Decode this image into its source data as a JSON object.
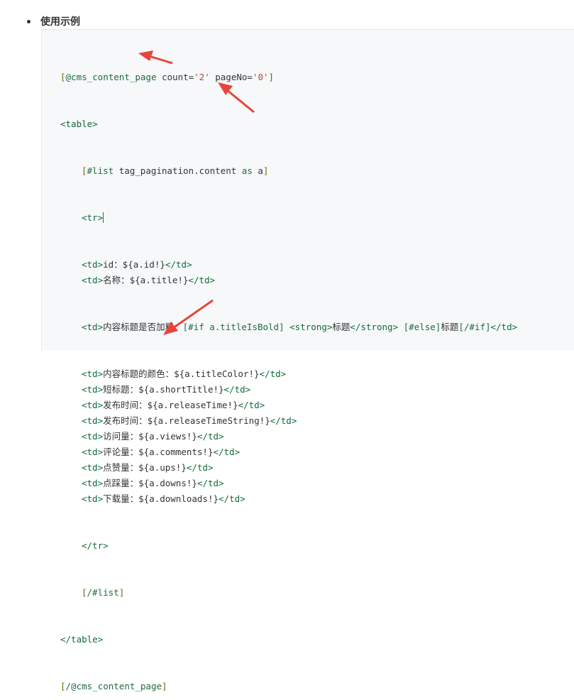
{
  "section": {
    "heading": "使用示例"
  },
  "code": {
    "line1": {
      "a": "[",
      "b": "@cms_content_page",
      "c": " count=",
      "d": "'2'",
      "e": " pageNo=",
      "f": "'0'",
      "g": "]"
    },
    "line2": "<table>",
    "line3": {
      "a": "[",
      "b": "#list",
      "c": " tag_pagination.content ",
      "d": "as",
      "e": " a",
      "f": "]"
    },
    "line4": "<tr>",
    "rows": [
      {
        "open": "<td>",
        "label": "id：",
        "expr": "${a.id!}",
        "close": "</td>"
      },
      {
        "open": "<td>",
        "label": "名称：",
        "expr": "${a.title!}",
        "close": "</td>"
      }
    ],
    "bold_row": {
      "open": "<td>",
      "label": "内容标题是否加粗：",
      "if_open": "[#if a.titleIsBold]",
      "strong_open": " <strong>",
      "strong_text": "标题",
      "strong_close": "</strong>",
      "else": " [#else]",
      "else_text": "标题",
      "endif": "[/#if]",
      "close": "</td>"
    },
    "rows2": [
      {
        "open": "<td>",
        "label": "内容标题的颜色：",
        "expr": "${a.titleColor!}",
        "close": "</td>"
      },
      {
        "open": "<td>",
        "label": "短标题：",
        "expr": "${a.shortTitle!}",
        "close": "</td>"
      },
      {
        "open": "<td>",
        "label": "发布时间：",
        "expr": "${a.releaseTime!}",
        "close": "</td>"
      },
      {
        "open": "<td>",
        "label": "发布时间：",
        "expr": "${a.releaseTimeString!}",
        "close": "</td>"
      },
      {
        "open": "<td>",
        "label": "访问量：",
        "expr": "${a.views!}",
        "close": "</td>"
      },
      {
        "open": "<td>",
        "label": "评论量：",
        "expr": "${a.comments!}",
        "close": "</td>"
      },
      {
        "open": "<td>",
        "label": "点赞量：",
        "expr": "${a.ups!}",
        "close": "</td>"
      },
      {
        "open": "<td>",
        "label": "点踩量：",
        "expr": "${a.downs!}",
        "close": "</td>"
      },
      {
        "open": "<td>",
        "label": "下载量：",
        "expr": "${a.downloads!}",
        "close": "</td>"
      }
    ],
    "tr_close": "</tr>",
    "list_close": {
      "a": "[",
      "b": "/#list",
      "c": "]"
    },
    "table_close": "</table>",
    "page_close": {
      "a": "[",
      "b": "/@cms_content_page",
      "c": "]"
    }
  },
  "colors": {
    "annotation_arrow": "#e8443a"
  }
}
